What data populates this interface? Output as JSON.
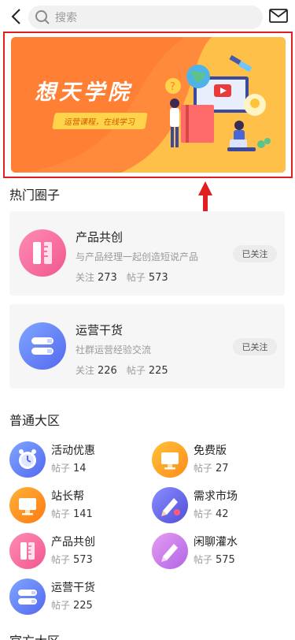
{
  "search": {
    "placeholder": "搜索"
  },
  "banner": {
    "title": "想天学院",
    "subtitle": "运营课程，在线学习"
  },
  "hot_section": {
    "title": "热门圈子"
  },
  "hot_circles": [
    {
      "name": "产品共创",
      "desc": "与产品经理一起创造短说产品",
      "follow_label": "关注",
      "follow_count": "273",
      "post_label": "帖子",
      "post_count": "573",
      "status": "已关注"
    },
    {
      "name": "运营干货",
      "desc": "社群运营经验交流",
      "follow_label": "关注",
      "follow_count": "226",
      "post_label": "帖子",
      "post_count": "225",
      "status": "已关注"
    }
  ],
  "normal_section": {
    "title": "普通大区"
  },
  "normal_items": [
    {
      "name": "活动优惠",
      "post_label": "帖子",
      "post_count": "14",
      "icon": "clock-icon"
    },
    {
      "name": "免费版",
      "post_label": "帖子",
      "post_count": "27",
      "icon": "monitor-icon"
    },
    {
      "name": "站长帮",
      "post_label": "帖子",
      "post_count": "141",
      "icon": "monitor-icon"
    },
    {
      "name": "需求市场",
      "post_label": "帖子",
      "post_count": "42",
      "icon": "pencil-icon"
    },
    {
      "name": "产品共创",
      "post_label": "帖子",
      "post_count": "573",
      "icon": "ruler-icon"
    },
    {
      "name": "闲聊灌水",
      "post_label": "帖子",
      "post_count": "575",
      "icon": "pencil-icon"
    },
    {
      "name": "运营干货",
      "post_label": "帖子",
      "post_count": "225",
      "icon": "book-icon"
    }
  ],
  "official_section": {
    "title": "官方大区"
  },
  "colors": {
    "annotation_red": "#e02020",
    "banner_orange": "#ff8b3d",
    "pink": "#f06a9e",
    "blue": "#5b7cf5",
    "orange": "#ff9a1a",
    "purple": "#b165e6"
  }
}
